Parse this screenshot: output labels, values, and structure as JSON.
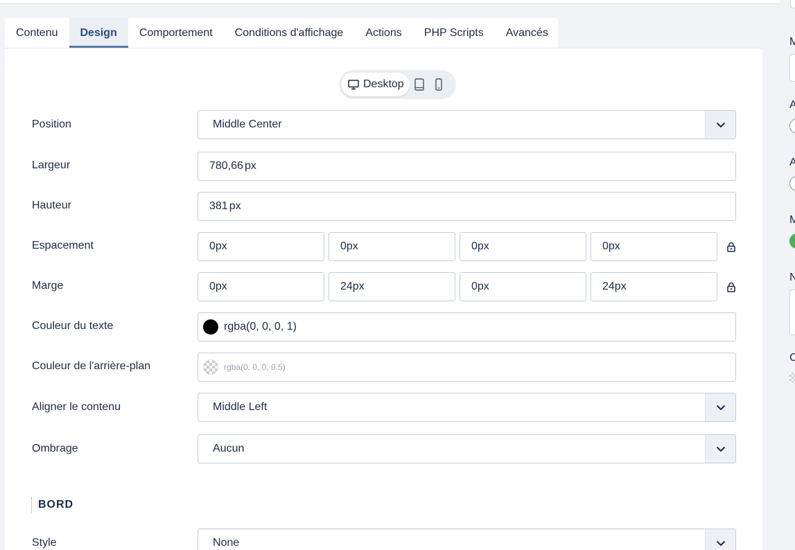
{
  "tabs": [
    {
      "label": "Contenu",
      "active": false
    },
    {
      "label": "Design",
      "active": true
    },
    {
      "label": "Comportement",
      "active": false
    },
    {
      "label": "Conditions d'affichage",
      "active": false
    },
    {
      "label": "Actions",
      "active": false
    },
    {
      "label": "PHP Scripts",
      "active": false
    },
    {
      "label": "Avancés",
      "active": false
    }
  ],
  "device_switch": {
    "desktop_label": "Desktop",
    "icons": [
      "desktop-icon",
      "tablet-icon",
      "mobile-icon"
    ]
  },
  "form": {
    "position": {
      "label": "Position",
      "value": "Middle Center"
    },
    "largeur": {
      "label": "Largeur",
      "value": "780,66",
      "unit": "px"
    },
    "hauteur": {
      "label": "Hauteur",
      "value": "381",
      "unit": "px"
    },
    "espacement": {
      "label": "Espacement",
      "values": [
        "0px",
        "0px",
        "0px",
        "0px"
      ]
    },
    "marge": {
      "label": "Marge",
      "values": [
        "0px",
        "24px",
        "0px",
        "24px"
      ]
    },
    "couleur_texte": {
      "label": "Couleur du texte",
      "value": "rgba(0, 0, 0, 1)"
    },
    "couleur_fond": {
      "label": "Couleur de l'arrière-plan",
      "placeholder": "rgba(0, 0, 0, 0.5)"
    },
    "aligner": {
      "label": "Aligner le contenu",
      "value": "Middle Left"
    },
    "ombrage": {
      "label": "Ombrage",
      "value": "Aucun"
    }
  },
  "border_section": {
    "title": "BORD",
    "style": {
      "label": "Style",
      "value": "None"
    }
  },
  "right_panel": {
    "letters": [
      "M",
      "A",
      "A",
      "M",
      "N",
      "C"
    ]
  },
  "colors": {
    "accent": "#5b79a8",
    "active_tab_text": "#284c7e",
    "text": "#1c2b45",
    "toggle_on": "#4caf50"
  }
}
